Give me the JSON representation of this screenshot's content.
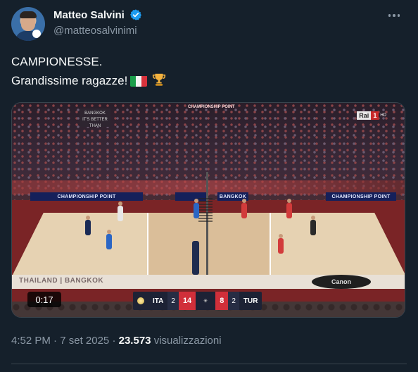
{
  "author": {
    "display_name": "Matteo Salvini",
    "handle": "@matteosalvinimi",
    "verified": true,
    "verified_color": "#1d9bf0"
  },
  "tweet": {
    "line1": "CAMPIONESSE.",
    "line2": "Grandissime ragazze!",
    "emojis": [
      "italian-flag-icon",
      "trophy-icon"
    ]
  },
  "video": {
    "duration": "0:17",
    "top_banner": "CHAMPIONSHIP POINT",
    "boards": [
      "CHAMPIONSHIP POINT",
      "CHAMPIONSHIP POINT"
    ],
    "mini_board_center": "BANGKOK",
    "bangkok_sign": [
      "BANGKOK",
      "IT'S BETTER THAN"
    ],
    "ad_left": "THAILAND | BANGKOK",
    "ad_right": "Canon",
    "broadcaster": {
      "name": "Rai",
      "channel": "1",
      "suffix": "HD"
    },
    "score": {
      "team_a": "ITA",
      "sets_a": "2",
      "points_a": "14",
      "points_b": "8",
      "sets_b": "2",
      "team_b": "TUR"
    }
  },
  "meta": {
    "time": "4:52 PM",
    "separator": "·",
    "date": "7 set 2025",
    "views_count": "23.573",
    "views_label": "visualizzazioni"
  },
  "colors": {
    "background": "#15202b",
    "text_primary": "#f7f9f9",
    "text_secondary": "#8b98a5",
    "border": "#38444d"
  }
}
